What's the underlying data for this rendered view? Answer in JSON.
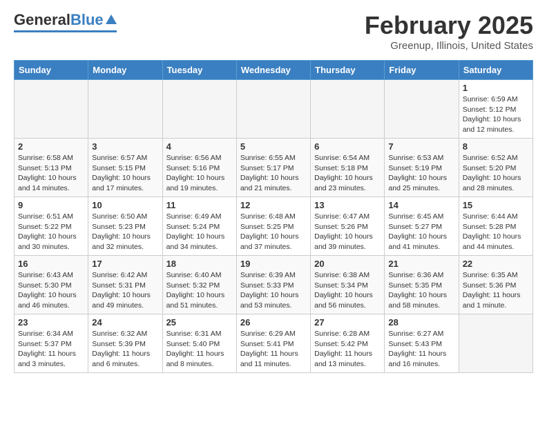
{
  "logo": {
    "general": "General",
    "blue": "Blue"
  },
  "title": "February 2025",
  "subtitle": "Greenup, Illinois, United States",
  "days_of_week": [
    "Sunday",
    "Monday",
    "Tuesday",
    "Wednesday",
    "Thursday",
    "Friday",
    "Saturday"
  ],
  "weeks": [
    [
      {
        "day": "",
        "info": ""
      },
      {
        "day": "",
        "info": ""
      },
      {
        "day": "",
        "info": ""
      },
      {
        "day": "",
        "info": ""
      },
      {
        "day": "",
        "info": ""
      },
      {
        "day": "",
        "info": ""
      },
      {
        "day": "1",
        "info": "Sunrise: 6:59 AM\nSunset: 5:12 PM\nDaylight: 10 hours\nand 12 minutes."
      }
    ],
    [
      {
        "day": "2",
        "info": "Sunrise: 6:58 AM\nSunset: 5:13 PM\nDaylight: 10 hours\nand 14 minutes."
      },
      {
        "day": "3",
        "info": "Sunrise: 6:57 AM\nSunset: 5:15 PM\nDaylight: 10 hours\nand 17 minutes."
      },
      {
        "day": "4",
        "info": "Sunrise: 6:56 AM\nSunset: 5:16 PM\nDaylight: 10 hours\nand 19 minutes."
      },
      {
        "day": "5",
        "info": "Sunrise: 6:55 AM\nSunset: 5:17 PM\nDaylight: 10 hours\nand 21 minutes."
      },
      {
        "day": "6",
        "info": "Sunrise: 6:54 AM\nSunset: 5:18 PM\nDaylight: 10 hours\nand 23 minutes."
      },
      {
        "day": "7",
        "info": "Sunrise: 6:53 AM\nSunset: 5:19 PM\nDaylight: 10 hours\nand 25 minutes."
      },
      {
        "day": "8",
        "info": "Sunrise: 6:52 AM\nSunset: 5:20 PM\nDaylight: 10 hours\nand 28 minutes."
      }
    ],
    [
      {
        "day": "9",
        "info": "Sunrise: 6:51 AM\nSunset: 5:22 PM\nDaylight: 10 hours\nand 30 minutes."
      },
      {
        "day": "10",
        "info": "Sunrise: 6:50 AM\nSunset: 5:23 PM\nDaylight: 10 hours\nand 32 minutes."
      },
      {
        "day": "11",
        "info": "Sunrise: 6:49 AM\nSunset: 5:24 PM\nDaylight: 10 hours\nand 34 minutes."
      },
      {
        "day": "12",
        "info": "Sunrise: 6:48 AM\nSunset: 5:25 PM\nDaylight: 10 hours\nand 37 minutes."
      },
      {
        "day": "13",
        "info": "Sunrise: 6:47 AM\nSunset: 5:26 PM\nDaylight: 10 hours\nand 39 minutes."
      },
      {
        "day": "14",
        "info": "Sunrise: 6:45 AM\nSunset: 5:27 PM\nDaylight: 10 hours\nand 41 minutes."
      },
      {
        "day": "15",
        "info": "Sunrise: 6:44 AM\nSunset: 5:28 PM\nDaylight: 10 hours\nand 44 minutes."
      }
    ],
    [
      {
        "day": "16",
        "info": "Sunrise: 6:43 AM\nSunset: 5:30 PM\nDaylight: 10 hours\nand 46 minutes."
      },
      {
        "day": "17",
        "info": "Sunrise: 6:42 AM\nSunset: 5:31 PM\nDaylight: 10 hours\nand 49 minutes."
      },
      {
        "day": "18",
        "info": "Sunrise: 6:40 AM\nSunset: 5:32 PM\nDaylight: 10 hours\nand 51 minutes."
      },
      {
        "day": "19",
        "info": "Sunrise: 6:39 AM\nSunset: 5:33 PM\nDaylight: 10 hours\nand 53 minutes."
      },
      {
        "day": "20",
        "info": "Sunrise: 6:38 AM\nSunset: 5:34 PM\nDaylight: 10 hours\nand 56 minutes."
      },
      {
        "day": "21",
        "info": "Sunrise: 6:36 AM\nSunset: 5:35 PM\nDaylight: 10 hours\nand 58 minutes."
      },
      {
        "day": "22",
        "info": "Sunrise: 6:35 AM\nSunset: 5:36 PM\nDaylight: 11 hours\nand 1 minute."
      }
    ],
    [
      {
        "day": "23",
        "info": "Sunrise: 6:34 AM\nSunset: 5:37 PM\nDaylight: 11 hours\nand 3 minutes."
      },
      {
        "day": "24",
        "info": "Sunrise: 6:32 AM\nSunset: 5:39 PM\nDaylight: 11 hours\nand 6 minutes."
      },
      {
        "day": "25",
        "info": "Sunrise: 6:31 AM\nSunset: 5:40 PM\nDaylight: 11 hours\nand 8 minutes."
      },
      {
        "day": "26",
        "info": "Sunrise: 6:29 AM\nSunset: 5:41 PM\nDaylight: 11 hours\nand 11 minutes."
      },
      {
        "day": "27",
        "info": "Sunrise: 6:28 AM\nSunset: 5:42 PM\nDaylight: 11 hours\nand 13 minutes."
      },
      {
        "day": "28",
        "info": "Sunrise: 6:27 AM\nSunset: 5:43 PM\nDaylight: 11 hours\nand 16 minutes."
      },
      {
        "day": "",
        "info": ""
      }
    ]
  ]
}
